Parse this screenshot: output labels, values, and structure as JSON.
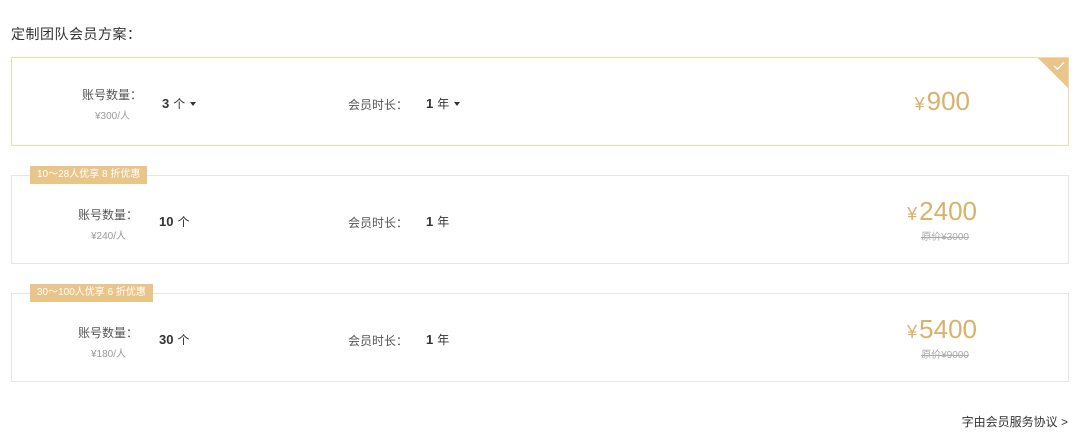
{
  "section_title": "定制团队会员方案：",
  "plans": [
    {
      "qty_label": "账号数量：",
      "unit_price": "¥300/人",
      "qty_value": "3",
      "qty_unit": "个",
      "duration_label": "会员时长：",
      "duration_value": "1",
      "duration_unit": "年",
      "price_symbol": "¥",
      "price": "900",
      "selected": true
    },
    {
      "badge": "10～28人优享 8 折优惠",
      "qty_label": "账号数量：",
      "unit_price": "¥240/人",
      "qty_value": "10",
      "qty_unit": "个",
      "duration_label": "会员时长：",
      "duration_value": "1",
      "duration_unit": "年",
      "price_symbol": "¥",
      "price": "2400",
      "original_price": "原价¥3000"
    },
    {
      "badge": "30～100人优享 6 折优惠",
      "qty_label": "账号数量：",
      "unit_price": "¥180/人",
      "qty_value": "30",
      "qty_unit": "个",
      "duration_label": "会员时长：",
      "duration_value": "1",
      "duration_unit": "年",
      "price_symbol": "¥",
      "price": "5400",
      "original_price": "原价¥9000"
    }
  ],
  "agreement_link": "字由会员服务协议 >",
  "colors": {
    "accent_gold": "#d9b26a",
    "badge_bg": "#e9c58a",
    "selected_border": "#f3d9a4"
  },
  "icons": {
    "selected_check": "check-icon",
    "dropdown": "caret-down-icon"
  }
}
